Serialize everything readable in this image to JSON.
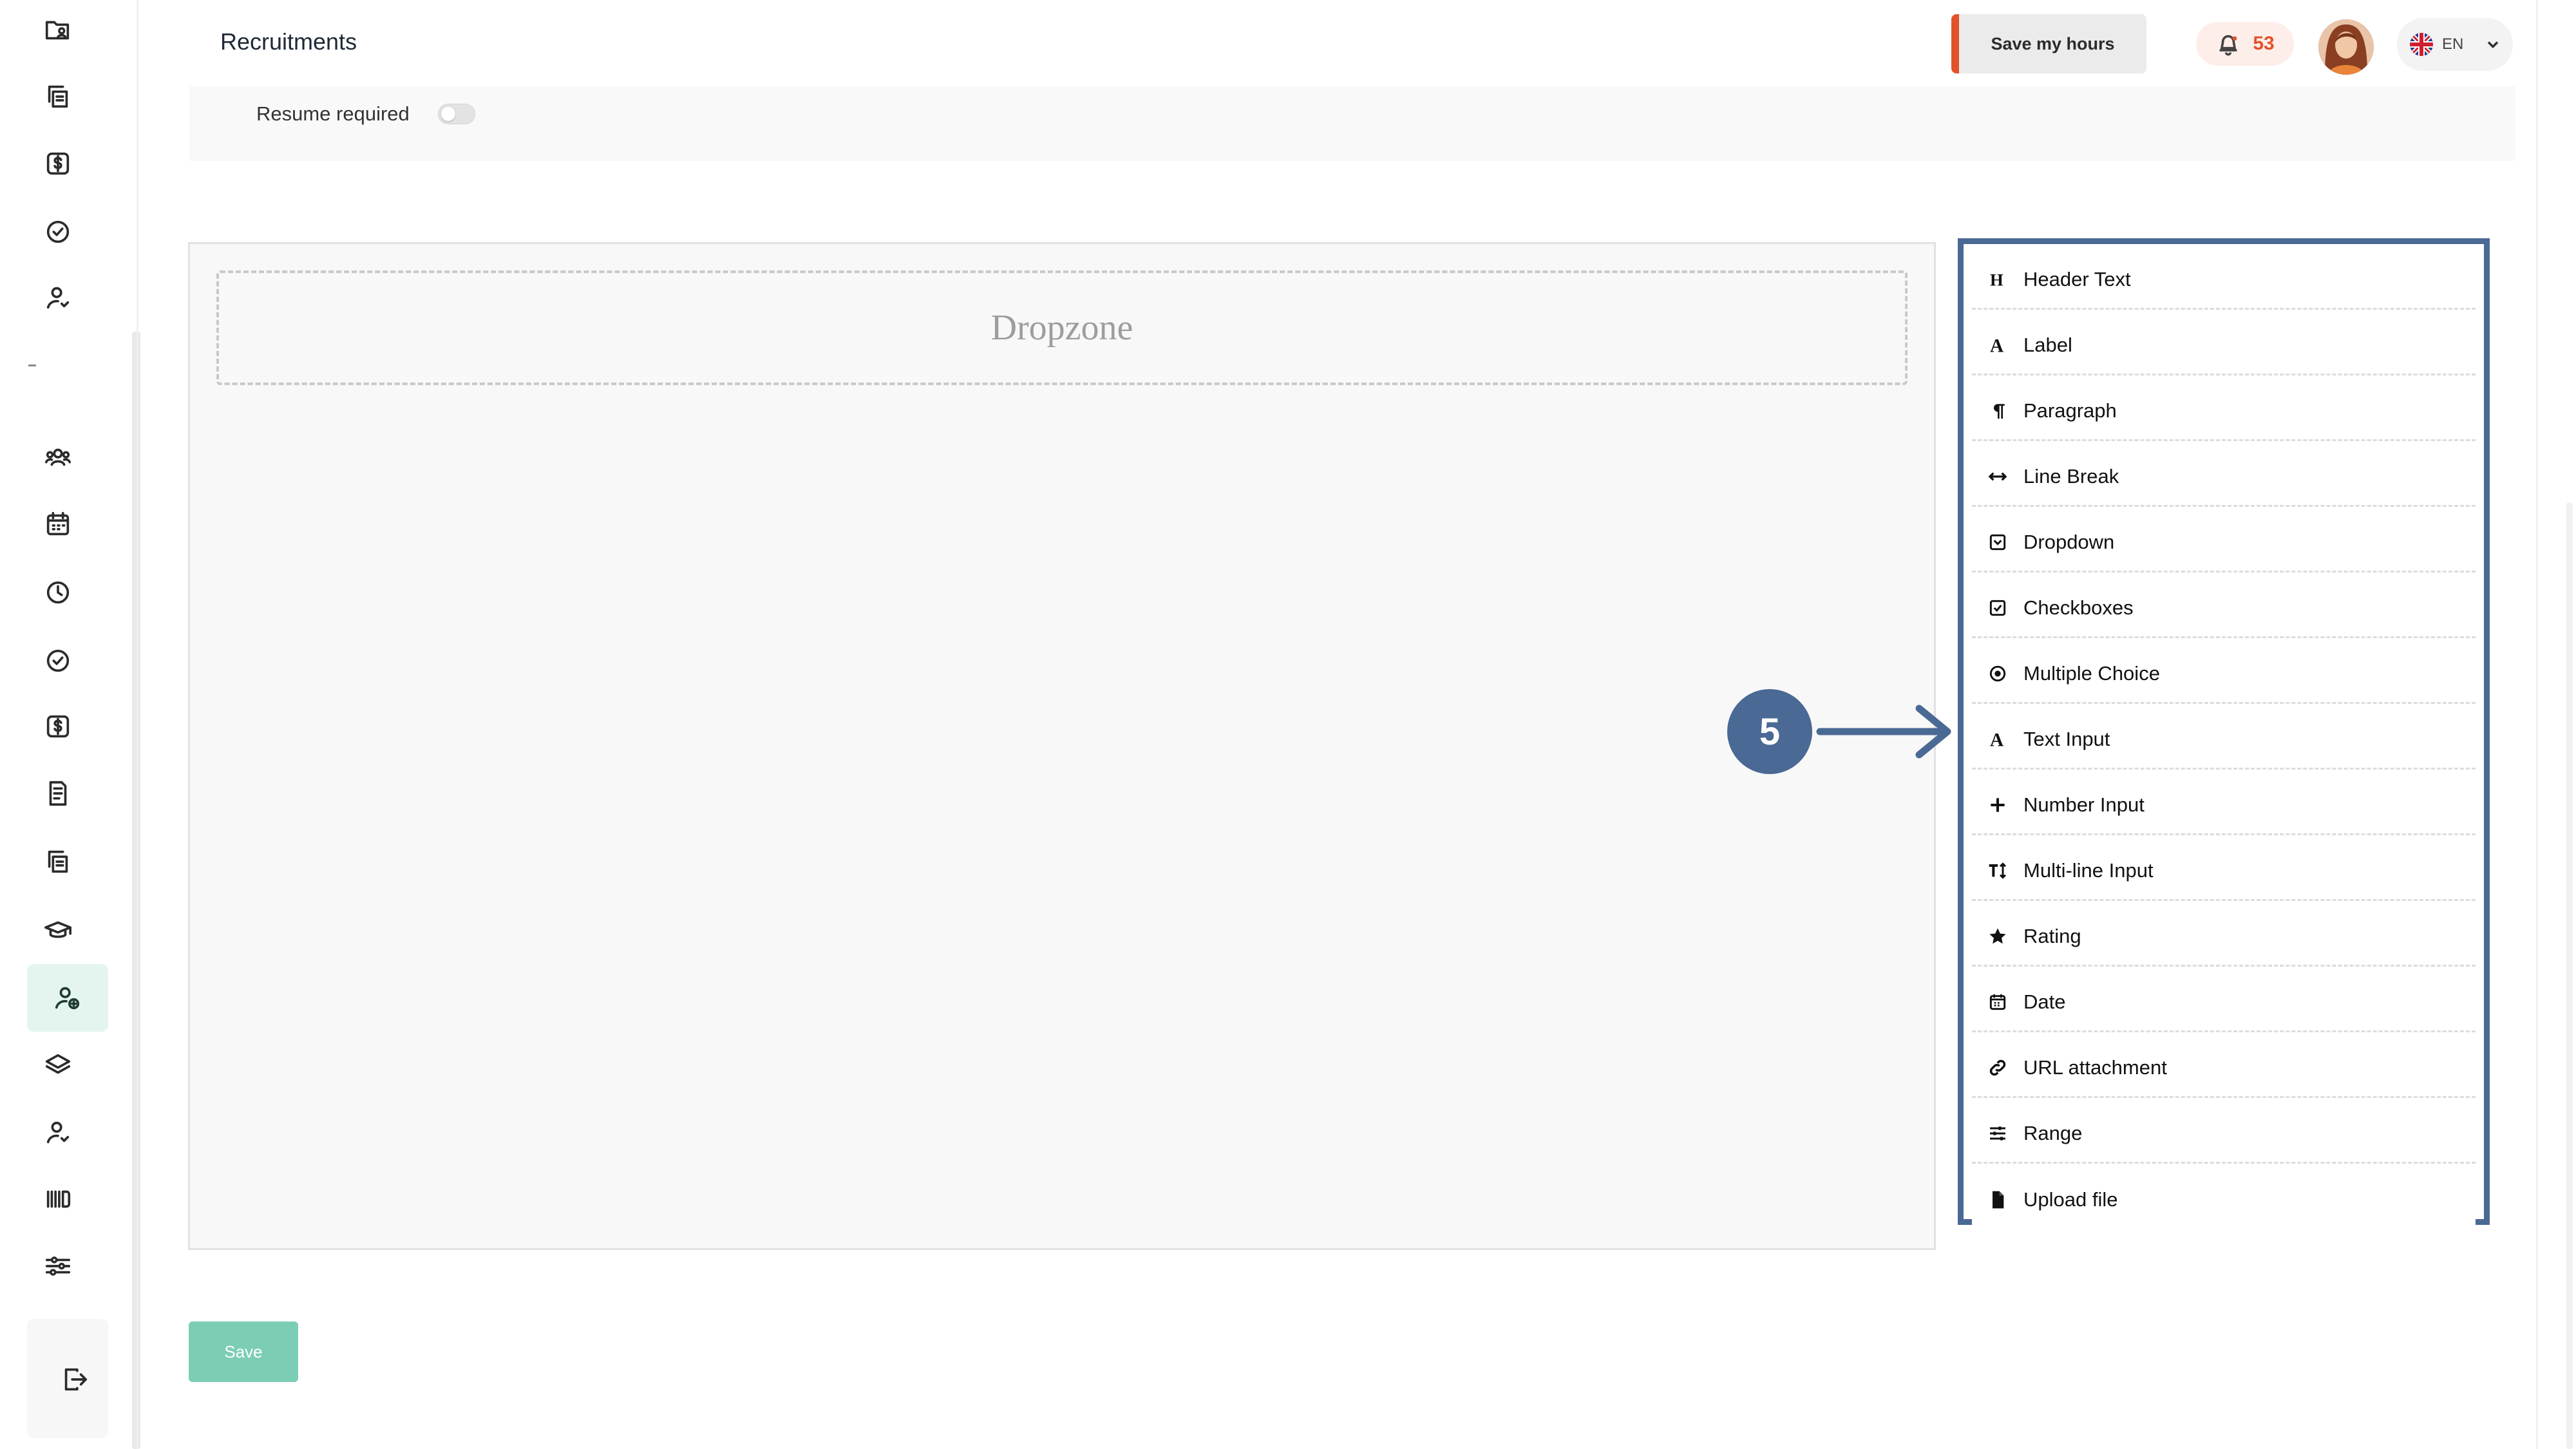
{
  "header": {
    "title": "Recruitments",
    "save_hours_label": "Save my hours",
    "notification_count": "53",
    "language_code": "EN"
  },
  "form_settings": {
    "resume_required_label": "Resume required",
    "resume_required_on": false
  },
  "builder": {
    "dropzone_label": "Dropzone",
    "toolbox_items": [
      {
        "label": "Header Text",
        "icon": "header-icon"
      },
      {
        "label": "Label",
        "icon": "label-icon"
      },
      {
        "label": "Paragraph",
        "icon": "paragraph-icon"
      },
      {
        "label": "Line Break",
        "icon": "line-break-icon"
      },
      {
        "label": "Dropdown",
        "icon": "dropdown-icon"
      },
      {
        "label": "Checkboxes",
        "icon": "checkbox-icon"
      },
      {
        "label": "Multiple Choice",
        "icon": "radio-icon"
      },
      {
        "label": "Text Input",
        "icon": "text-input-icon"
      },
      {
        "label": "Number Input",
        "icon": "plus-icon"
      },
      {
        "label": "Multi-line Input",
        "icon": "text-height-icon"
      },
      {
        "label": "Rating",
        "icon": "star-icon"
      },
      {
        "label": "Date",
        "icon": "calendar-icon"
      },
      {
        "label": "URL attachment",
        "icon": "link-icon"
      },
      {
        "label": "Range",
        "icon": "sliders-icon"
      },
      {
        "label": "Upload file",
        "icon": "file-icon"
      }
    ]
  },
  "callout": {
    "step": "5"
  },
  "footer": {
    "save_label": "Save"
  },
  "sidebar": {
    "icons": [
      "folder-user-icon",
      "copy-icon",
      "dollar-icon",
      "check-circle-icon",
      "user-icon",
      "team-icon",
      "calendar-icon",
      "clock-icon",
      "check-circle-icon",
      "dollar-icon",
      "document-list-icon",
      "copy-icon",
      "graduation-cap-icon",
      "recruitment-icon",
      "layers-icon",
      "user-icon",
      "barcode-icon",
      "sliders-icon",
      "logout-icon"
    ],
    "active": "recruitment-icon"
  },
  "colors": {
    "accent_orange": "#e2522a",
    "callout_blue": "#4a6994",
    "save_green": "#7ccdb5",
    "active_nav_bg": "#e4f5ef"
  }
}
